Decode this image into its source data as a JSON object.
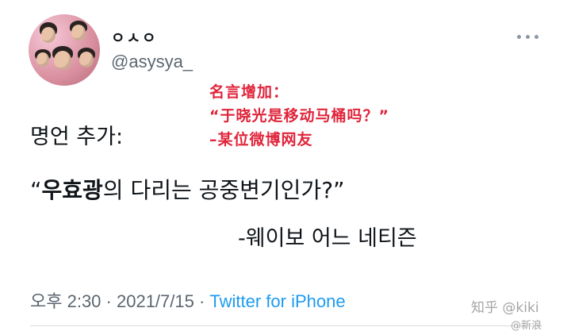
{
  "tweet": {
    "display_name": "ㅇㅅㅇ",
    "handle": "@asysya_",
    "text_line1": "명언 추가:",
    "text_line2_quote_open": "“",
    "text_line2_bold": "우효광",
    "text_line2_rest": "의 다리는 공중변기인가?”",
    "text_line3": "-웨이보 어느 네티즌",
    "time": "오후 2:30",
    "separator1": " · ",
    "date": "2021/7/15",
    "separator2": " · ",
    "source": "Twitter for iPhone"
  },
  "annotation": {
    "line1": "名言增加：",
    "line2": "“于晓光是移动马桶吗？”",
    "line3": "–某位微博网友",
    "color": "#e0243a"
  },
  "watermark": {
    "text": "知乎 @kiki",
    "text2": "@新浪"
  },
  "icons": {
    "more": "more-horizontal-icon"
  },
  "colors": {
    "secondary_text": "#5b6670",
    "link": "#1d9bf0"
  }
}
